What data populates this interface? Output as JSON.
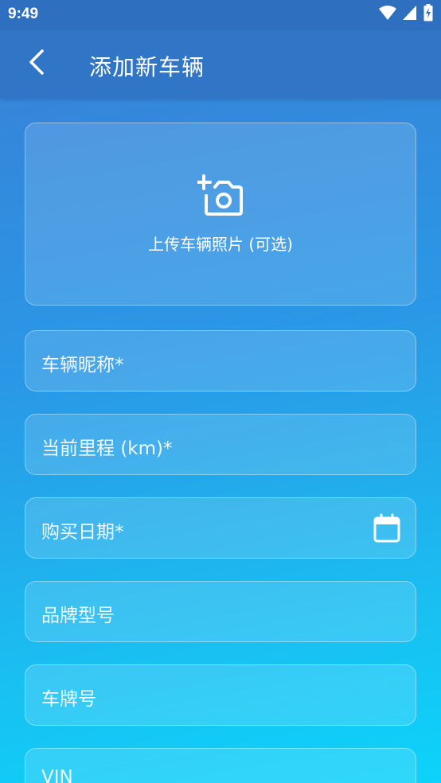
{
  "status_bar": {
    "time": "9:49",
    "icons": [
      "wifi-icon",
      "cell-signal-icon",
      "battery-charging-icon"
    ]
  },
  "app_bar": {
    "back_icon": "back-arrow-icon",
    "title": "添加新车辆"
  },
  "photo_upload": {
    "icon": "add-photo-camera-icon",
    "label": "上传车辆照片 (可选)"
  },
  "form": {
    "fields": [
      {
        "label": "车辆昵称*",
        "value": ""
      },
      {
        "label": "当前里程 (km)*",
        "value": ""
      },
      {
        "label": "购买日期*",
        "value": "",
        "trailing_icon": "calendar-icon"
      },
      {
        "label": "品牌型号",
        "value": ""
      },
      {
        "label": "车牌号",
        "value": ""
      },
      {
        "label": "VIN",
        "value": ""
      }
    ]
  },
  "colors": {
    "app_bar": "#3075c6",
    "status_bar": "#2f6fbf",
    "gradient_top": "#3a7fd6",
    "gradient_bottom": "#0cd3fb",
    "text": "#ffffff"
  }
}
